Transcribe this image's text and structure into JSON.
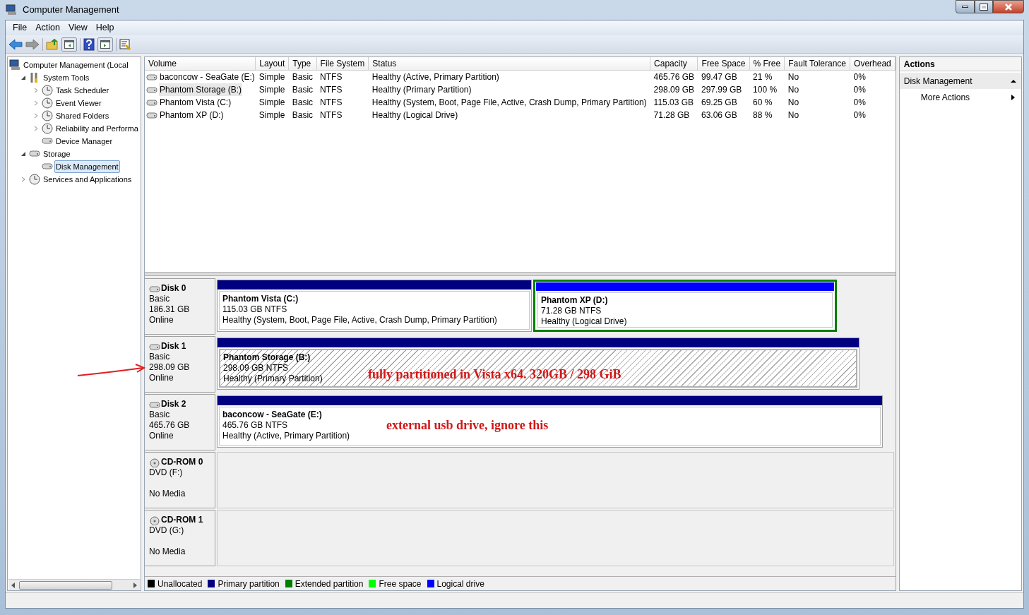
{
  "window": {
    "title": "Computer Management"
  },
  "menu": [
    {
      "label": "File"
    },
    {
      "label": "Action"
    },
    {
      "label": "View"
    },
    {
      "label": "Help"
    }
  ],
  "tree": [
    {
      "label": "Computer Management (Local",
      "selected": false,
      "children": [
        {
          "label": "System Tools",
          "expanded": true,
          "selected": false,
          "children": [
            {
              "label": "Task Scheduler",
              "expanded": false,
              "selected": false
            },
            {
              "label": "Event Viewer",
              "expanded": false,
              "selected": false
            },
            {
              "label": "Shared Folders",
              "expanded": false,
              "selected": false
            },
            {
              "label": "Reliability and Performa",
              "expanded": false,
              "selected": false
            },
            {
              "label": "Device Manager",
              "selected": false
            }
          ]
        },
        {
          "label": "Storage",
          "expanded": true,
          "selected": false,
          "children": [
            {
              "label": "Disk Management",
              "selected": true
            }
          ]
        },
        {
          "label": "Services and Applications",
          "expanded": false,
          "selected": false
        }
      ]
    }
  ],
  "volume_table": {
    "columns": [
      "Volume",
      "Layout",
      "Type",
      "File System",
      "Status",
      "Capacity",
      "Free Space",
      "% Free",
      "Fault Tolerance",
      "Overhead"
    ],
    "rows": [
      {
        "selected": false,
        "cells": [
          "baconcow - SeaGate (E:)",
          "Simple",
          "Basic",
          "NTFS",
          "Healthy (Active, Primary Partition)",
          "465.76 GB",
          "99.47 GB",
          "21 %",
          "No",
          "0%"
        ]
      },
      {
        "selected": true,
        "cells": [
          "Phantom Storage (B:)",
          "Simple",
          "Basic",
          "NTFS",
          "Healthy (Primary Partition)",
          "298.09 GB",
          "297.99 GB",
          "100 %",
          "No",
          "0%"
        ]
      },
      {
        "selected": false,
        "cells": [
          "Phantom Vista (C:)",
          "Simple",
          "Basic",
          "NTFS",
          "Healthy (System, Boot, Page File, Active, Crash Dump, Primary Partition)",
          "115.03 GB",
          "69.25 GB",
          "60 %",
          "No",
          "0%"
        ]
      },
      {
        "selected": false,
        "cells": [
          "Phantom XP (D:)",
          "Simple",
          "Basic",
          "NTFS",
          "Healthy (Logical Drive)",
          "71.28 GB",
          "63.06 GB",
          "88 %",
          "No",
          "0%"
        ]
      }
    ]
  },
  "disks": [
    {
      "kind": "disk",
      "name": "Disk 0",
      "type": "Basic",
      "size": "186.31 GB",
      "state": "Online",
      "partitions": [
        {
          "kind": "primary",
          "selected": false,
          "name": "Phantom Vista  (C:)",
          "size": "115.03 GB NTFS",
          "status": "Healthy (System, Boot, Page File, Active, Crash Dump, Primary Partition)"
        },
        {
          "kind": "logical",
          "selected": false,
          "name": "Phantom XP  (D:)",
          "size": "71.28 GB NTFS",
          "status": "Healthy (Logical Drive)"
        }
      ]
    },
    {
      "kind": "disk",
      "name": "Disk 1",
      "type": "Basic",
      "size": "298.09 GB",
      "state": "Online",
      "partitions": [
        {
          "kind": "primary",
          "selected": true,
          "name": "Phantom Storage  (B:)",
          "size": "298.09 GB NTFS",
          "status": "Healthy (Primary Partition)"
        }
      ]
    },
    {
      "kind": "disk",
      "name": "Disk 2",
      "type": "Basic",
      "size": "465.76 GB",
      "state": "Online",
      "partitions": [
        {
          "kind": "primary",
          "selected": false,
          "name": "baconcow - SeaGate  (E:)",
          "size": "465.76 GB NTFS",
          "status": "Healthy (Active, Primary Partition)"
        }
      ]
    },
    {
      "kind": "cdrom",
      "name": "CD-ROM 0",
      "type": "DVD (F:)",
      "state": "No Media"
    },
    {
      "kind": "cdrom",
      "name": "CD-ROM 1",
      "type": "DVD (G:)",
      "state": "No Media"
    }
  ],
  "legend": [
    {
      "label": "Unallocated",
      "color": "#000000"
    },
    {
      "label": "Primary partition",
      "color": "#000080"
    },
    {
      "label": "Extended partition",
      "color": "#008000"
    },
    {
      "label": "Free space",
      "color": "#00ff00"
    },
    {
      "label": "Logical drive",
      "color": "#0000ff"
    }
  ],
  "actions": {
    "title": "Actions",
    "section": "Disk Management",
    "expanded": true,
    "items": [
      "More Actions"
    ]
  },
  "annotations": [
    "fully partitioned in Vista x64. 320GB / 298 GiB",
    "external usb drive, ignore this"
  ]
}
